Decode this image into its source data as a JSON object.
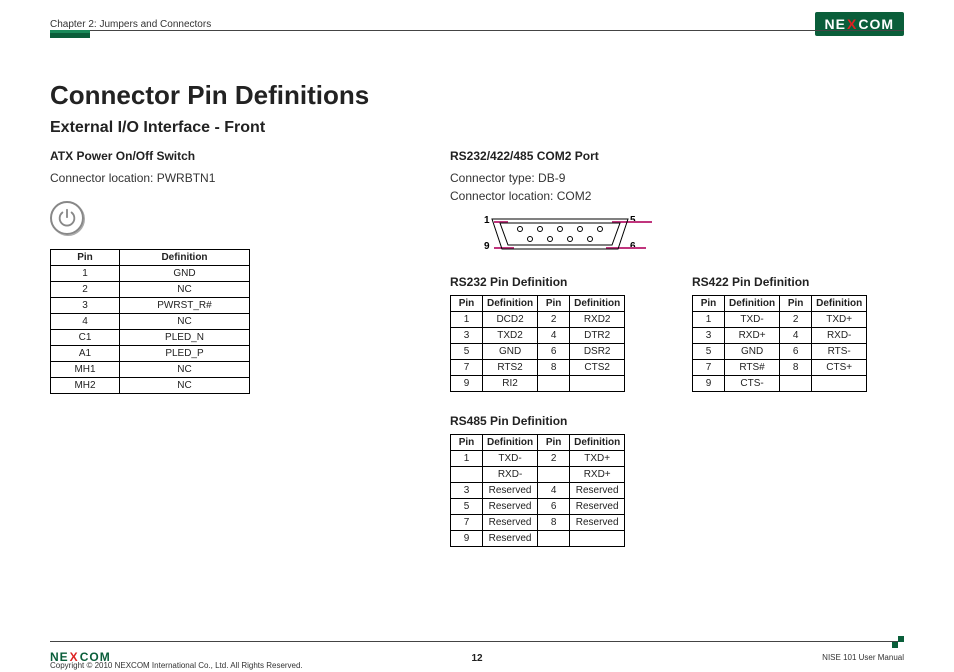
{
  "header": {
    "chapter": "Chapter 2: Jumpers and Connectors",
    "brand_pre": "NE",
    "brand_x": "X",
    "brand_post": "COM"
  },
  "title": "Connector Pin Definitions",
  "subtitle": "External I/O Interface - Front",
  "left": {
    "h3": "ATX Power On/Off Switch",
    "loc": "Connector location: PWRBTN1",
    "th_pin": "Pin",
    "th_def": "Definition",
    "rows": [
      {
        "p": "1",
        "d": "GND"
      },
      {
        "p": "2",
        "d": "NC"
      },
      {
        "p": "3",
        "d": "PWRST_R#"
      },
      {
        "p": "4",
        "d": "NC"
      },
      {
        "p": "C1",
        "d": "PLED_N"
      },
      {
        "p": "A1",
        "d": "PLED_P"
      },
      {
        "p": "MH1",
        "d": "NC"
      },
      {
        "p": "MH2",
        "d": "NC"
      }
    ]
  },
  "right": {
    "h3": "RS232/422/485 COM2 Port",
    "type": "Connector type: DB-9",
    "loc": "Connector location: COM2",
    "diagram": {
      "l1": "1",
      "l5": "5",
      "l9": "9",
      "l6": "6"
    },
    "rs232_title": "RS232 Pin Definition",
    "rs422_title": "RS422 Pin Definition",
    "rs485_title": "RS485 Pin Definition",
    "th_pin": "Pin",
    "th_def": "Definition",
    "rs232": [
      {
        "p1": "1",
        "d1": "DCD2",
        "p2": "2",
        "d2": "RXD2"
      },
      {
        "p1": "3",
        "d1": "TXD2",
        "p2": "4",
        "d2": "DTR2"
      },
      {
        "p1": "5",
        "d1": "GND",
        "p2": "6",
        "d2": "DSR2"
      },
      {
        "p1": "7",
        "d1": "RTS2",
        "p2": "8",
        "d2": "CTS2"
      },
      {
        "p1": "9",
        "d1": "RI2",
        "p2": "",
        "d2": ""
      }
    ],
    "rs422": [
      {
        "p1": "1",
        "d1": "TXD-",
        "p2": "2",
        "d2": "TXD+"
      },
      {
        "p1": "3",
        "d1": "RXD+",
        "p2": "4",
        "d2": "RXD-"
      },
      {
        "p1": "5",
        "d1": "GND",
        "p2": "6",
        "d2": "RTS-"
      },
      {
        "p1": "7",
        "d1": "RTS#",
        "p2": "8",
        "d2": "CTS+"
      },
      {
        "p1": "9",
        "d1": "CTS-",
        "p2": "",
        "d2": ""
      }
    ],
    "rs485": [
      {
        "p1": "1",
        "d1": "TXD-",
        "p2": "2",
        "d2": "TXD+"
      },
      {
        "p1": "",
        "d1": "RXD-",
        "p2": "",
        "d2": "RXD+"
      },
      {
        "p1": "3",
        "d1": "Reserved",
        "p2": "4",
        "d2": "Reserved"
      },
      {
        "p1": "5",
        "d1": "Reserved",
        "p2": "6",
        "d2": "Reserved"
      },
      {
        "p1": "7",
        "d1": "Reserved",
        "p2": "8",
        "d2": "Reserved"
      },
      {
        "p1": "9",
        "d1": "Reserved",
        "p2": "",
        "d2": ""
      }
    ]
  },
  "footer": {
    "copyright": "Copyright © 2010 NEXCOM International Co., Ltd. All Rights Reserved.",
    "page": "12",
    "manual": "NISE 101 User Manual"
  }
}
